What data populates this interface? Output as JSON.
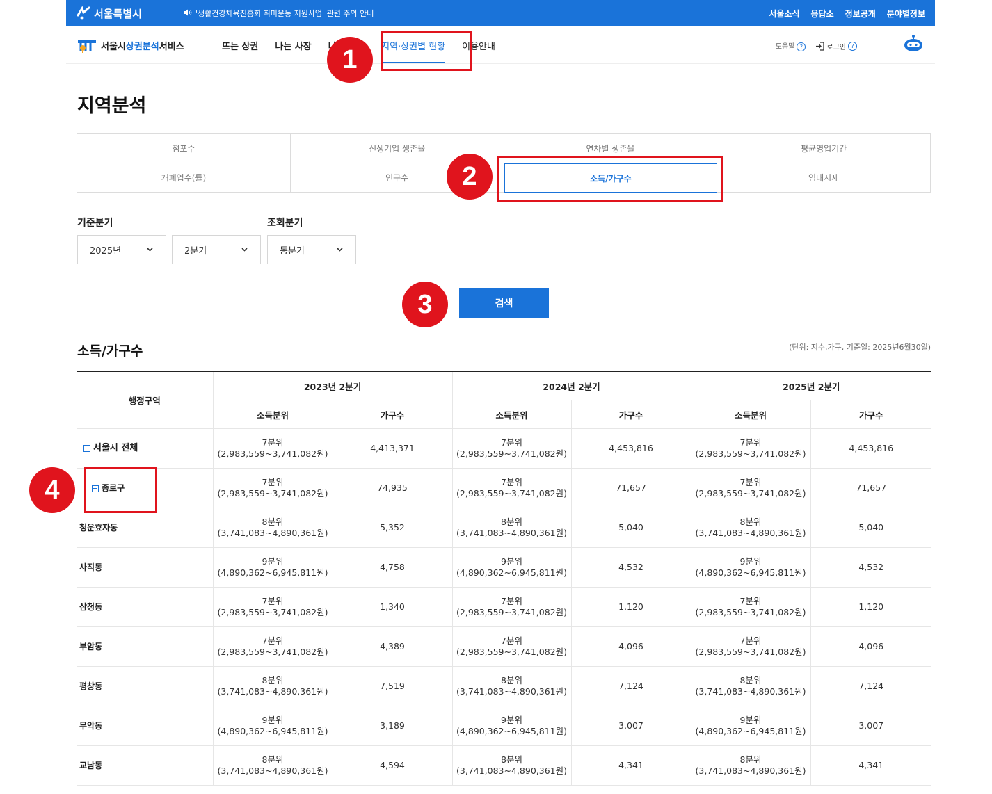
{
  "topbar": {
    "logo_text": "서울특별시",
    "notice": "'생활건강체육진흥회 취미운동 지원사업' 관련 주의 안내",
    "links": [
      "서울소식",
      "응답소",
      "정보공개",
      "분야별정보"
    ]
  },
  "header": {
    "brand_prefix": "서울시 ",
    "brand_highlight": "상권분석",
    "brand_suffix": "서비스",
    "nav": [
      "뜨는 상권",
      "나는 사장",
      "나도 사장",
      "지역·상권별 현황",
      "이용안내"
    ],
    "help": "도움말",
    "login": "로그인"
  },
  "page_title": "지역분석",
  "tabs": [
    "점포수",
    "신생기업 생존율",
    "연차별 생존율",
    "평균영업기간",
    "개폐업수(률)",
    "인구수",
    "소득/가구수",
    "임대시세"
  ],
  "active_tab": "소득/가구수",
  "filters": {
    "base_label": "기준분기",
    "query_label": "조회분기",
    "year": "2025년",
    "quarter": "2분기",
    "compare": "동분기"
  },
  "search_label": "검색",
  "section_title": "소득/가구수",
  "unit_note": "(단위: 지수,가구, 기준일: 2025년6월30일)",
  "table": {
    "region_header": "행정구역",
    "periods": [
      "2023년 2분기",
      "2024년 2분기",
      "2025년 2분기"
    ],
    "sub_headers": [
      "소득분위",
      "가구수"
    ],
    "rows": [
      {
        "name": "서울시 전체",
        "toggle": true,
        "level": 0,
        "cells": [
          [
            "7분위",
            "(2,983,559~3,741,082원)",
            "4,413,371"
          ],
          [
            "7분위",
            "(2,983,559~3,741,082원)",
            "4,453,816"
          ],
          [
            "7분위",
            "(2,983,559~3,741,082원)",
            "4,453,816"
          ]
        ]
      },
      {
        "name": "종로구",
        "toggle": true,
        "level": 1,
        "cells": [
          [
            "7분위",
            "(2,983,559~3,741,082원)",
            "74,935"
          ],
          [
            "7분위",
            "(2,983,559~3,741,082원)",
            "71,657"
          ],
          [
            "7분위",
            "(2,983,559~3,741,082원)",
            "71,657"
          ]
        ]
      },
      {
        "name": "청운효자동",
        "toggle": false,
        "level": 2,
        "cells": [
          [
            "8분위",
            "(3,741,083~4,890,361원)",
            "5,352"
          ],
          [
            "8분위",
            "(3,741,083~4,890,361원)",
            "5,040"
          ],
          [
            "8분위",
            "(3,741,083~4,890,361원)",
            "5,040"
          ]
        ]
      },
      {
        "name": "사직동",
        "toggle": false,
        "level": 2,
        "cells": [
          [
            "9분위",
            "(4,890,362~6,945,811원)",
            "4,758"
          ],
          [
            "9분위",
            "(4,890,362~6,945,811원)",
            "4,532"
          ],
          [
            "9분위",
            "(4,890,362~6,945,811원)",
            "4,532"
          ]
        ]
      },
      {
        "name": "삼청동",
        "toggle": false,
        "level": 2,
        "cells": [
          [
            "7분위",
            "(2,983,559~3,741,082원)",
            "1,340"
          ],
          [
            "7분위",
            "(2,983,559~3,741,082원)",
            "1,120"
          ],
          [
            "7분위",
            "(2,983,559~3,741,082원)",
            "1,120"
          ]
        ]
      },
      {
        "name": "부암동",
        "toggle": false,
        "level": 2,
        "cells": [
          [
            "7분위",
            "(2,983,559~3,741,082원)",
            "4,389"
          ],
          [
            "7분위",
            "(2,983,559~3,741,082원)",
            "4,096"
          ],
          [
            "7분위",
            "(2,983,559~3,741,082원)",
            "4,096"
          ]
        ]
      },
      {
        "name": "평창동",
        "toggle": false,
        "level": 2,
        "cells": [
          [
            "8분위",
            "(3,741,083~4,890,361원)",
            "7,519"
          ],
          [
            "8분위",
            "(3,741,083~4,890,361원)",
            "7,124"
          ],
          [
            "8분위",
            "(3,741,083~4,890,361원)",
            "7,124"
          ]
        ]
      },
      {
        "name": "무악동",
        "toggle": false,
        "level": 2,
        "cells": [
          [
            "9분위",
            "(4,890,362~6,945,811원)",
            "3,189"
          ],
          [
            "9분위",
            "(4,890,362~6,945,811원)",
            "3,007"
          ],
          [
            "9분위",
            "(4,890,362~6,945,811원)",
            "3,007"
          ]
        ]
      },
      {
        "name": "교남동",
        "toggle": false,
        "level": 2,
        "cells": [
          [
            "8분위",
            "(3,741,083~4,890,361원)",
            "4,594"
          ],
          [
            "8분위",
            "(3,741,083~4,890,361원)",
            "4,341"
          ],
          [
            "8분위",
            "(3,741,083~4,890,361원)",
            "4,341"
          ]
        ]
      }
    ]
  },
  "annotations": [
    "1",
    "2",
    "3",
    "4"
  ],
  "colors": {
    "primary": "#1a73d9",
    "annotation": "#e0141d"
  }
}
